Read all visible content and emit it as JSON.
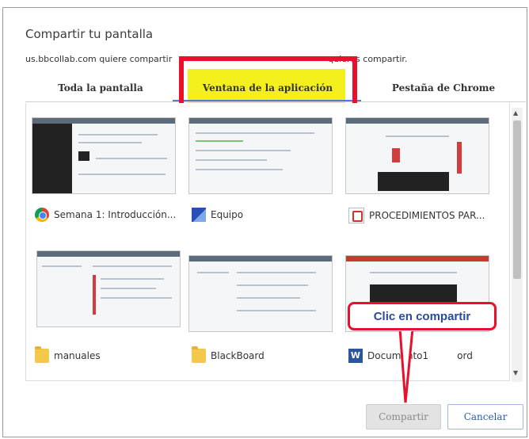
{
  "dialog": {
    "title": "Compartir tu pantalla",
    "subtitle_visible": "us.bbcollab.com quiere compartir",
    "subtitle_tail": "quieres compartir."
  },
  "tabs": [
    {
      "label": "Toda la pantalla"
    },
    {
      "label": "Ventana de la aplicación",
      "selected": true
    },
    {
      "label": "Pestaña de Chrome"
    }
  ],
  "windows": [
    {
      "label": "Semana 1: Introducción...",
      "icon": "chrome-icon"
    },
    {
      "label": "Equipo",
      "icon": "network-icon"
    },
    {
      "label": "PROCEDIMIENTOS PAR...",
      "icon": "pdf-icon"
    },
    {
      "label": "manuales",
      "icon": "folder-icon"
    },
    {
      "label": "BlackBoard",
      "icon": "folder-icon"
    },
    {
      "label": "Documento1",
      "label_suffix": "ord",
      "icon": "word-icon"
    }
  ],
  "callout": {
    "text": "Clic en compartir"
  },
  "buttons": {
    "share": "Compartir",
    "cancel": "Cancelar"
  },
  "colors": {
    "highlight": "#f4f01e",
    "annotation_red": "#e8102a",
    "accent_blue": "#4a7fd4"
  }
}
